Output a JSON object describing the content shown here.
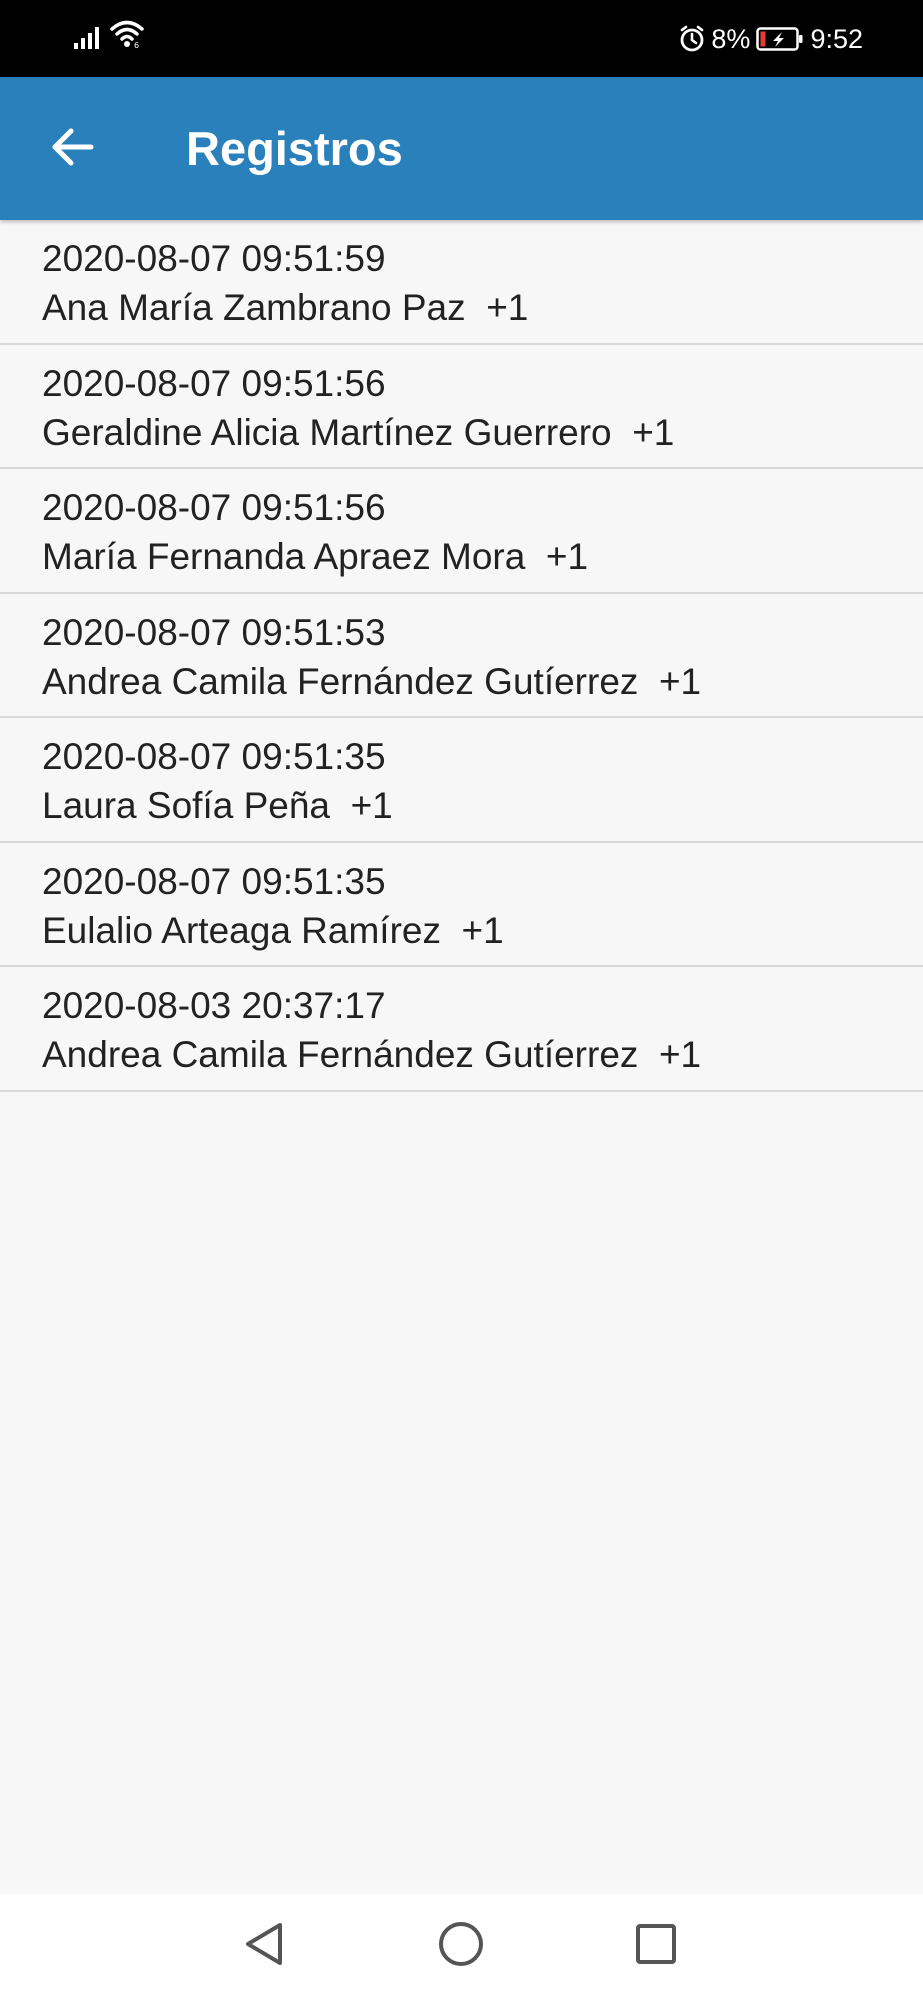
{
  "status_bar": {
    "battery_percent": "8%",
    "time": "9:52",
    "icons": [
      "signal-icon",
      "wifi-icon",
      "alarm-icon",
      "battery-icon"
    ]
  },
  "app_bar": {
    "title": "Registros",
    "back_icon": "arrow-left-icon"
  },
  "records": [
    {
      "timestamp": "2020-08-07 09:51:59",
      "name": "Ana María Zambrano Paz",
      "delta": "+1"
    },
    {
      "timestamp": "2020-08-07 09:51:56",
      "name": "Geraldine Alicia Martínez Guerrero",
      "delta": "+1"
    },
    {
      "timestamp": "2020-08-07 09:51:56",
      "name": "María Fernanda Apraez Mora",
      "delta": "+1"
    },
    {
      "timestamp": "2020-08-07 09:51:53",
      "name": "Andrea Camila Fernández Gutíerrez",
      "delta": "+1"
    },
    {
      "timestamp": "2020-08-07 09:51:35",
      "name": "Laura Sofía Peña",
      "delta": "+1"
    },
    {
      "timestamp": "2020-08-07 09:51:35",
      "name": "Eulalio Arteaga Ramírez",
      "delta": "+1"
    },
    {
      "timestamp": "2020-08-03 20:37:17",
      "name": "Andrea Camila Fernández Gutíerrez",
      "delta": "+1"
    }
  ],
  "nav_bar": {
    "icons": [
      "back-triangle-icon",
      "home-circle-icon",
      "recents-square-icon"
    ]
  },
  "colors": {
    "app_bar": "#2a80bb",
    "background": "#f7f7f7",
    "divider": "#d9d9d9",
    "battery_low": "#e53935"
  }
}
